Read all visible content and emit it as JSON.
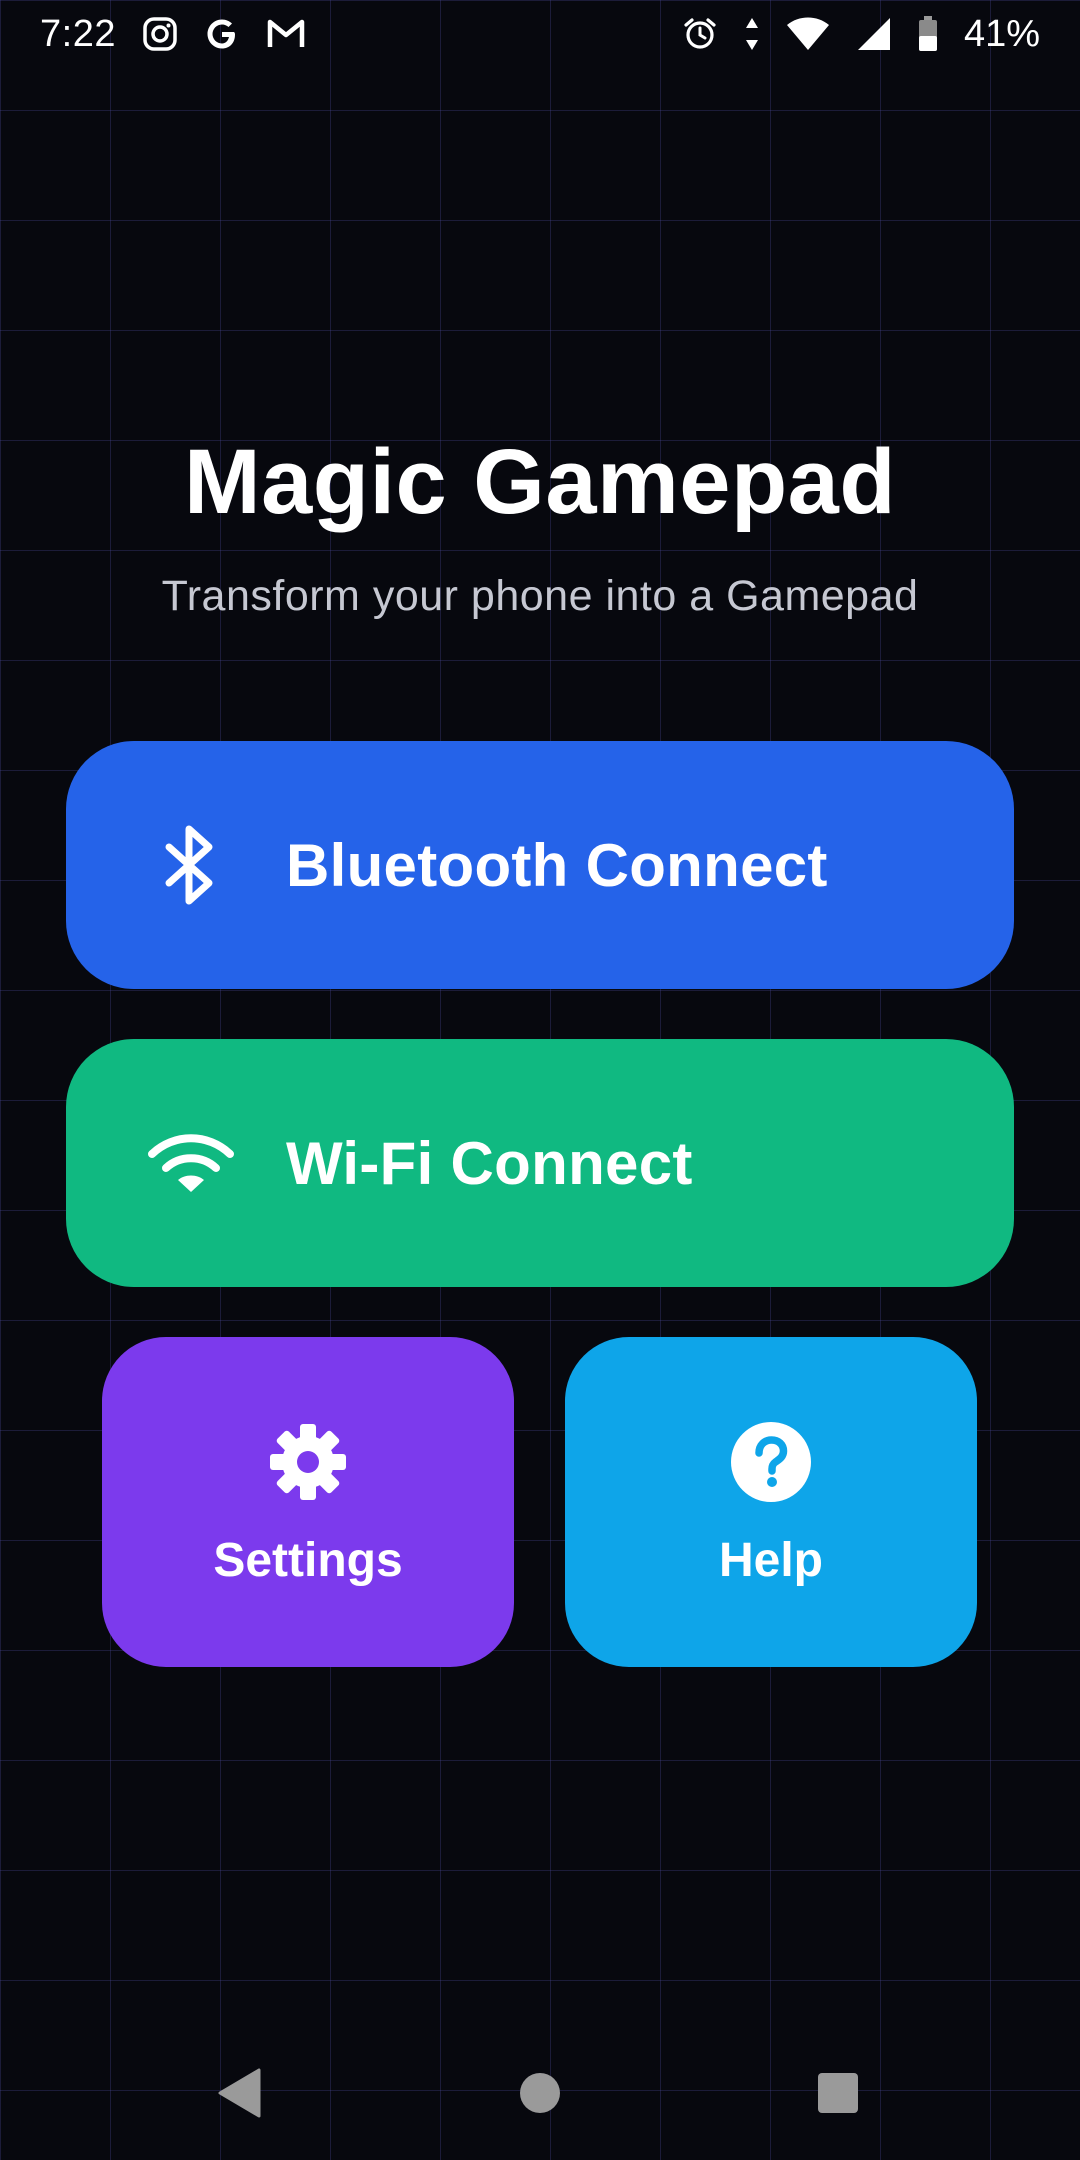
{
  "status_bar": {
    "time": "7:22",
    "battery_percent": "41%",
    "battery_level": 0.41,
    "left_icons": [
      "instagram-icon",
      "google-icon",
      "gmail-icon"
    ],
    "right_icons": [
      "alarm-icon",
      "data-arrows-icon",
      "wifi-signal-icon",
      "cell-signal-icon",
      "battery-icon"
    ]
  },
  "header": {
    "title": "Magic Gamepad",
    "subtitle": "Transform your phone into a Gamepad"
  },
  "buttons": {
    "bluetooth": {
      "label": "Bluetooth Connect",
      "icon": "bluetooth-icon",
      "color": "#2563e9"
    },
    "wifi": {
      "label": "Wi-Fi Connect",
      "icon": "wifi-icon",
      "color": "#10b981"
    },
    "settings": {
      "label": "Settings",
      "icon": "gear-icon",
      "color": "#7c3aed"
    },
    "help": {
      "label": "Help",
      "icon": "help-circle-icon",
      "color": "#0ea5e9"
    }
  },
  "nav_bar": {
    "buttons": [
      "back-icon",
      "home-icon",
      "recents-icon"
    ]
  },
  "theme": {
    "background": "#07080e",
    "grid_line": "#2a2c5a",
    "subtitle_color": "#c6c8d2"
  }
}
